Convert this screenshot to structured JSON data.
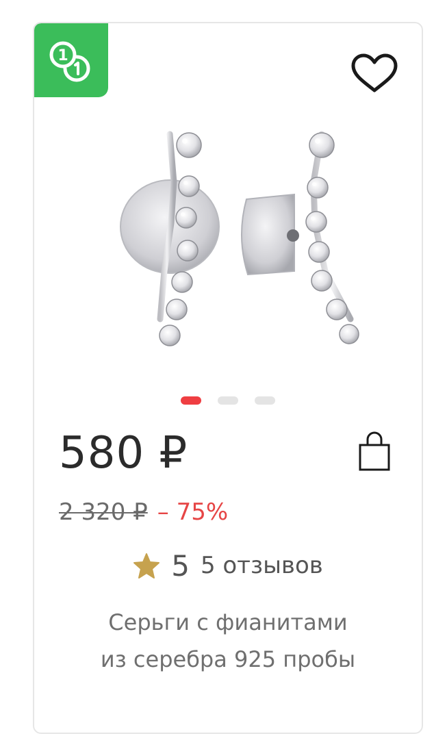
{
  "badge": {
    "icon": "coin-exchange-icon",
    "color": "#3bbd5a"
  },
  "favorite": {
    "icon": "heart-icon"
  },
  "gallery": {
    "image": "silver-earrings-with-cubic-zirconia-photo",
    "slides_total": 3,
    "active_slide": 1
  },
  "price": {
    "current": "580 ₽",
    "old": "2 320 ₽",
    "discount": "– 75%"
  },
  "cart": {
    "icon": "shopping-bag-icon"
  },
  "rating": {
    "star_icon": "star-icon",
    "score": "5",
    "reviews": "5 отзывов"
  },
  "product": {
    "title_line1": "Серьги с фианитами",
    "title_line2": "из серебра 925 пробы"
  },
  "colors": {
    "accent": "#ef3e42",
    "badge": "#3bbd5a",
    "star": "#c6a24e",
    "text": "#2b2b2b"
  }
}
